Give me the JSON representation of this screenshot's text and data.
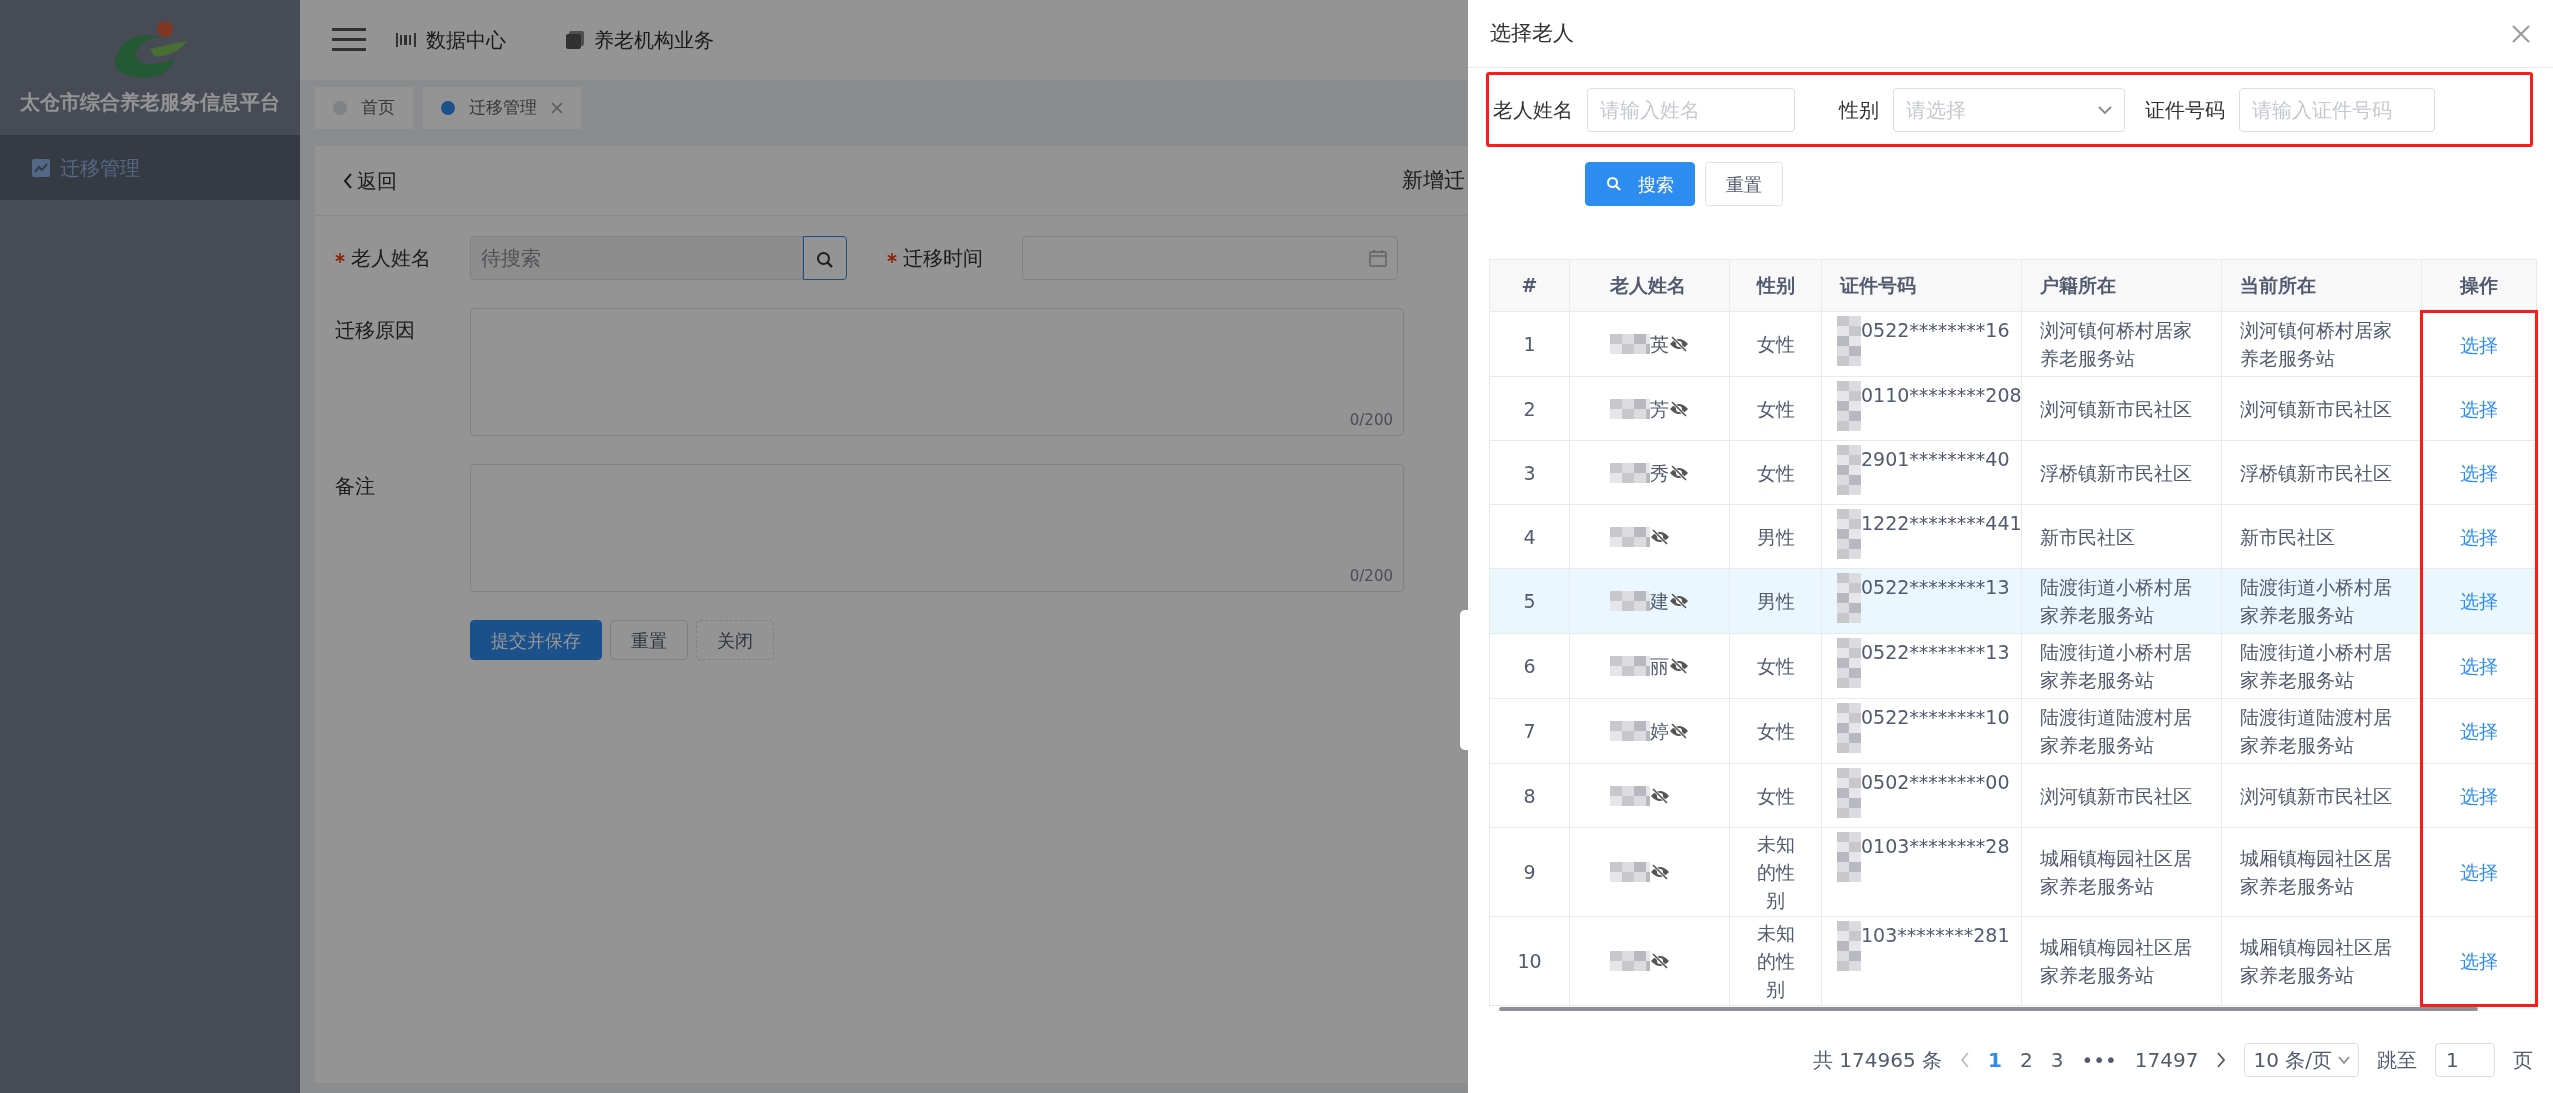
{
  "sidebar": {
    "logo_title": "太仓市综合养老服务信息平台",
    "items": [
      {
        "label": "迁移管理",
        "selected": true
      }
    ]
  },
  "top_nav": {
    "items": [
      {
        "label": "数据中心",
        "kind": "data"
      },
      {
        "label": "养老机构业务",
        "kind": "org"
      }
    ]
  },
  "tabs": [
    {
      "label": "首页",
      "selected": false,
      "closable": false
    },
    {
      "label": "迁移管理",
      "selected": true,
      "closable": true
    }
  ],
  "page": {
    "back": "返回",
    "title": "新增迁",
    "form": {
      "name_label": "老人姓名",
      "name_placeholder": "待搜索",
      "time_label": "迁移时间",
      "reason_label": "迁移原因",
      "reason_counter": "0/200",
      "note_label": "备注",
      "note_counter": "0/200"
    },
    "buttons": [
      {
        "label": "提交并保存",
        "kind": "primary"
      },
      {
        "label": "重置",
        "kind": "default"
      },
      {
        "label": "关闭",
        "kind": "dashed"
      }
    ]
  },
  "drawer": {
    "title": "选择老人",
    "filters": {
      "highlighted": true,
      "fields": [
        {
          "label": "老人姓名",
          "placeholder": "请输入姓名",
          "kind": "input"
        },
        {
          "label": "性别",
          "placeholder": "请选择",
          "kind": "select"
        },
        {
          "label": "证件号码",
          "placeholder": "请输入证件号码",
          "kind": "input"
        }
      ]
    },
    "buttons": [
      {
        "label": "搜索",
        "kind": "primary"
      },
      {
        "label": "重置",
        "kind": "default"
      }
    ],
    "table": {
      "columns": [
        {
          "label": "#"
        },
        {
          "label": "老人姓名"
        },
        {
          "label": "性别"
        },
        {
          "label": "证件号码"
        },
        {
          "label": "户籍所在"
        },
        {
          "label": "当前所在"
        },
        {
          "label": "操作",
          "highlighted": true
        }
      ],
      "rows": [
        {
          "index": "1",
          "name": "英",
          "gender": "女性",
          "id_number": "0522********16",
          "hukou": "浏河镇何桥村居家养老服务站",
          "current": "浏河镇何桥村居家养老服务站",
          "action": "选择",
          "selected": false
        },
        {
          "index": "2",
          "name": "芳",
          "gender": "女性",
          "id_number": "0110********208",
          "hukou": "浏河镇新市民社区",
          "current": "浏河镇新市民社区",
          "action": "选择",
          "selected": false
        },
        {
          "index": "3",
          "name": "秀",
          "gender": "女性",
          "id_number": "2901********40",
          "hukou": "浮桥镇新市民社区",
          "current": "浮桥镇新市民社区",
          "action": "选择",
          "selected": false
        },
        {
          "index": "4",
          "gender": "男性",
          "id_number": "1222********441",
          "hukou": "新市民社区",
          "current": "新市民社区",
          "action": "选择",
          "selected": false
        },
        {
          "index": "5",
          "name": "建",
          "gender": "男性",
          "id_number": "0522********13",
          "hukou": "陆渡街道小桥村居家养老服务站",
          "current": "陆渡街道小桥村居家养老服务站",
          "action": "选择",
          "selected": true
        },
        {
          "index": "6",
          "name": "丽",
          "gender": "女性",
          "id_number": "0522********13",
          "hukou": "陆渡街道小桥村居家养老服务站",
          "current": "陆渡街道小桥村居家养老服务站",
          "action": "选择",
          "selected": false
        },
        {
          "index": "7",
          "name": "婷",
          "gender": "女性",
          "id_number": "0522********10",
          "hukou": "陆渡街道陆渡村居家养老服务站",
          "current": "陆渡街道陆渡村居家养老服务站",
          "action": "选择",
          "selected": false
        },
        {
          "index": "8",
          "gender": "女性",
          "id_number": "0502********00",
          "hukou": "浏河镇新市民社区",
          "current": "浏河镇新市民社区",
          "action": "选择",
          "selected": false
        },
        {
          "index": "9",
          "gender": "未知的性别",
          "id_number": "0103********28",
          "hukou": "城厢镇梅园社区居家养老服务站",
          "current": "城厢镇梅园社区居家养老服务站",
          "action": "选择",
          "selected": false
        },
        {
          "index": "10",
          "gender": "未知的性别",
          "id_number": "103********281",
          "hukou": "城厢镇梅园社区居家养老服务站",
          "current": "城厢镇梅园社区居家养老服务站",
          "action": "选择",
          "selected": false
        }
      ]
    },
    "pagination": {
      "total": "共 174965 条",
      "pages": [
        {
          "label": "1",
          "kind": "page",
          "selected": true
        },
        {
          "label": "2",
          "kind": "page",
          "selected": false
        },
        {
          "label": "3",
          "kind": "page",
          "selected": false
        },
        {
          "label": "•••",
          "kind": "ellipsis"
        },
        {
          "label": "17497",
          "kind": "page",
          "selected": false
        }
      ],
      "page_size": "10 条/页",
      "jump_label": "跳至",
      "jump_value": "1",
      "page_unit": "页"
    }
  }
}
